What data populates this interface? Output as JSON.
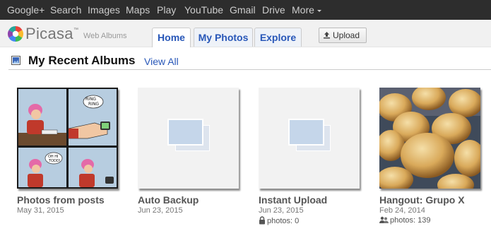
{
  "gbar": {
    "items": [
      "Google+",
      "Search",
      "Images",
      "Maps",
      "Play",
      "YouTube",
      "Gmail",
      "Drive",
      "More"
    ]
  },
  "logo": {
    "text": "Picasa",
    "tm": "™",
    "subtitle": "Web Albums"
  },
  "tabs": [
    {
      "label": "Home",
      "active": true
    },
    {
      "label": "My Photos",
      "active": false
    },
    {
      "label": "Explore",
      "active": false
    }
  ],
  "upload": {
    "label": "Upload"
  },
  "section": {
    "title": "My Recent Albums",
    "view_all": "View All"
  },
  "albums": [
    {
      "title": "Photos from posts",
      "date": "May 31, 2015",
      "meta": "",
      "thumb": "comic-thumbnail"
    },
    {
      "title": "Auto Backup",
      "date": "Jun 23, 2015",
      "meta": "",
      "thumb": "placeholder"
    },
    {
      "title": "Instant Upload",
      "date": "Jun 23, 2015",
      "meta": "photos: 0",
      "meta_icon": "lock-icon",
      "thumb": "placeholder"
    },
    {
      "title": "Hangout: Grupo X",
      "date": "Feb 24, 2014",
      "meta": "photos: 139",
      "meta_icon": "people-icon",
      "thumb": "bread-rolls-photo"
    }
  ],
  "colors": {
    "link": "#2857b8",
    "bar_bg": "#2d2d2d",
    "header_bg": "#f1f1f1"
  }
}
